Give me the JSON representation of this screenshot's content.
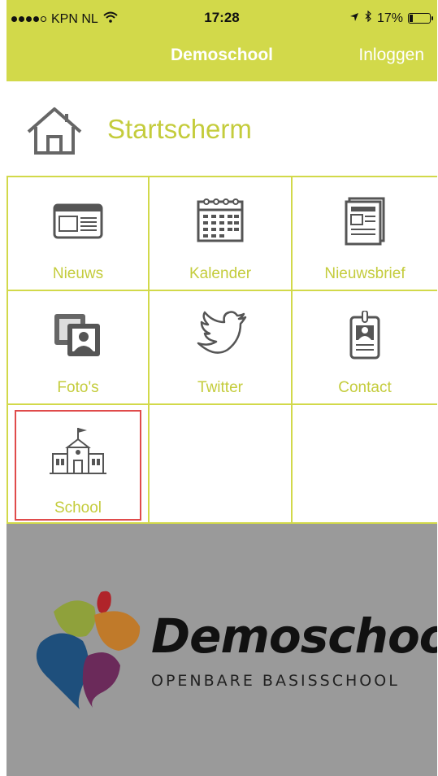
{
  "status_bar": {
    "carrier": "KPN NL",
    "time": "17:28",
    "battery": "17%"
  },
  "nav": {
    "title": "Demoschool",
    "login_label": "Inloggen"
  },
  "page": {
    "title": "Startscherm"
  },
  "tiles": [
    {
      "label": "Nieuws",
      "icon": "news-icon"
    },
    {
      "label": "Kalender",
      "icon": "calendar-icon"
    },
    {
      "label": "Nieuwsbrief",
      "icon": "newsletter-icon"
    },
    {
      "label": "Foto's",
      "icon": "photos-icon"
    },
    {
      "label": "Twitter",
      "icon": "twitter-icon"
    },
    {
      "label": "Contact",
      "icon": "contact-card-icon"
    },
    {
      "label": "School",
      "icon": "school-building-icon"
    }
  ],
  "footer": {
    "logo_main": "Demoschool",
    "logo_sub": "OPENBARE BASISSCHOOL"
  },
  "colors": {
    "accent": "#d2d94a",
    "accent_text": "#c4cc3c",
    "footer_bg": "#9a9a9a",
    "selection": "#e04b4b"
  }
}
